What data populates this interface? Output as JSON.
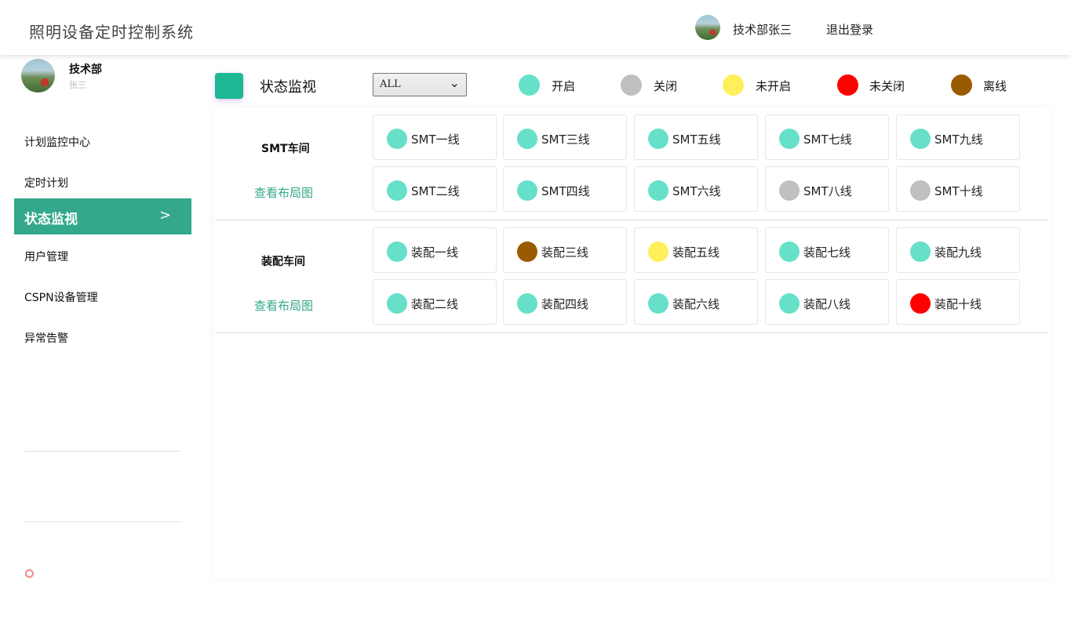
{
  "header": {
    "title": "照明设备定时控制系统",
    "user": "技术部张三",
    "logout": "退出登录"
  },
  "sidebar": {
    "dept": "技术部",
    "name": "张三",
    "items": [
      {
        "label": "计划监控中心"
      },
      {
        "label": "定时计划"
      },
      {
        "label": "状态监视"
      },
      {
        "label": "用户管理"
      },
      {
        "label": "CSPN设备管理"
      },
      {
        "label": "异常告警"
      }
    ],
    "active_chevron": ">"
  },
  "toolbar": {
    "title": "状态监视",
    "filter_value": "ALL",
    "legend": [
      {
        "label": "开启",
        "color": "#66e0c8"
      },
      {
        "label": "关闭",
        "color": "#c0c0c0"
      },
      {
        "label": "未开启",
        "color": "#ffef5a"
      },
      {
        "label": "未关闭",
        "color": "#ff0000"
      },
      {
        "label": "离线",
        "color": "#9a5b00"
      }
    ]
  },
  "workshops": [
    {
      "name": "SMT车间",
      "link": "查看布局图",
      "lines": [
        {
          "name": "SMT一线",
          "status": "on"
        },
        {
          "name": "SMT三线",
          "status": "on"
        },
        {
          "name": "SMT五线",
          "status": "on"
        },
        {
          "name": "SMT七线",
          "status": "on"
        },
        {
          "name": "SMT九线",
          "status": "on"
        },
        {
          "name": "SMT二线",
          "status": "on"
        },
        {
          "name": "SMT四线",
          "status": "on"
        },
        {
          "name": "SMT六线",
          "status": "on"
        },
        {
          "name": "SMT八线",
          "status": "off"
        },
        {
          "name": "SMT十线",
          "status": "off"
        }
      ]
    },
    {
      "name": "装配车间",
      "link": "查看布局图",
      "lines": [
        {
          "name": "装配一线",
          "status": "on"
        },
        {
          "name": "装配三线",
          "status": "offline"
        },
        {
          "name": "装配五线",
          "status": "not-on"
        },
        {
          "name": "装配七线",
          "status": "on"
        },
        {
          "name": "装配九线",
          "status": "on"
        },
        {
          "name": "装配二线",
          "status": "on"
        },
        {
          "name": "装配四线",
          "status": "on"
        },
        {
          "name": "装配六线",
          "status": "on"
        },
        {
          "name": "装配八线",
          "status": "on"
        },
        {
          "name": "装配十线",
          "status": "not-off"
        }
      ]
    }
  ],
  "status_colors": {
    "on": "#66e0c8",
    "off": "#c0c0c0",
    "not-on": "#ffef5a",
    "not-off": "#ff0000",
    "offline": "#9a5b00"
  }
}
